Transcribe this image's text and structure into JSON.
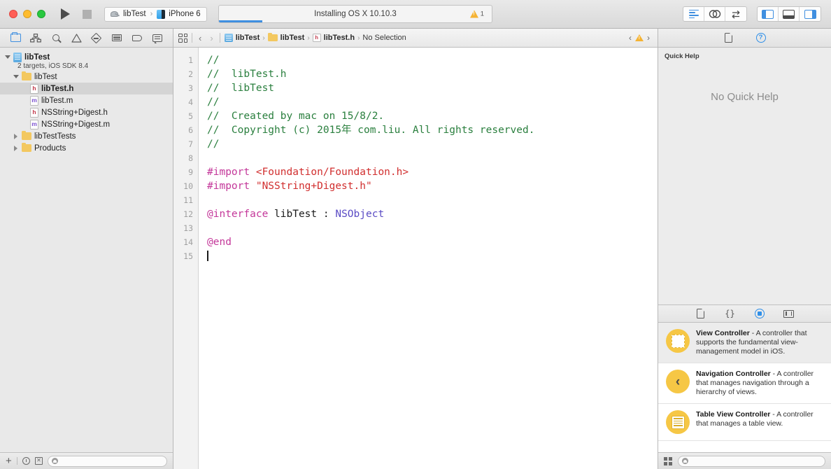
{
  "toolbar": {
    "run_label": "Run",
    "stop_label": "Stop",
    "scheme": {
      "project": "libTest",
      "separator": "›",
      "destination": "iPhone 6"
    },
    "status": {
      "text": "Installing OS X 10.10.3",
      "progress_percent": 16,
      "warning_count": "1"
    },
    "editor_modes": [
      "standard-editor",
      "assistant-editor",
      "version-editor"
    ],
    "view_toggles": [
      "navigator-pane",
      "debug-pane",
      "utilities-pane"
    ]
  },
  "navigator": {
    "tabs": [
      "project-navigator",
      "symbol-navigator",
      "find-navigator",
      "issue-navigator",
      "test-navigator",
      "debug-navigator",
      "breakpoint-navigator",
      "report-navigator"
    ],
    "project": {
      "name": "libTest",
      "subtitle": "2 targets, iOS SDK 8.4"
    },
    "tree": [
      {
        "label": "libTest",
        "kind": "folder",
        "depth": 1,
        "expanded": true,
        "selected": false
      },
      {
        "label": "libTest.h",
        "kind": "header",
        "depth": 2,
        "expanded": null,
        "selected": true
      },
      {
        "label": "libTest.m",
        "kind": "impl",
        "depth": 2,
        "expanded": null,
        "selected": false
      },
      {
        "label": "NSString+Digest.h",
        "kind": "header",
        "depth": 2,
        "expanded": null,
        "selected": false
      },
      {
        "label": "NSString+Digest.m",
        "kind": "impl",
        "depth": 2,
        "expanded": null,
        "selected": false
      },
      {
        "label": "libTestTests",
        "kind": "folder",
        "depth": 1,
        "expanded": false,
        "selected": false
      },
      {
        "label": "Products",
        "kind": "folder",
        "depth": 1,
        "expanded": false,
        "selected": false
      }
    ],
    "footer": {
      "add_label": "+",
      "filter_placeholder": ""
    }
  },
  "editor": {
    "jumpbar": {
      "breadcrumbs": [
        "libTest",
        "libTest",
        "libTest.h",
        "No Selection"
      ],
      "separator": "›",
      "back_label": "‹",
      "forward_label": "›",
      "prev_issue_label": "‹",
      "next_issue_label": "›"
    },
    "line_numbers": [
      "1",
      "2",
      "3",
      "4",
      "5",
      "6",
      "7",
      "8",
      "9",
      "10",
      "11",
      "12",
      "13",
      "14",
      "15"
    ],
    "code_lines": [
      {
        "n": 1,
        "tokens": [
          {
            "t": "//",
            "c": "cm"
          }
        ]
      },
      {
        "n": 2,
        "tokens": [
          {
            "t": "//  libTest.h",
            "c": "cm"
          }
        ]
      },
      {
        "n": 3,
        "tokens": [
          {
            "t": "//  libTest",
            "c": "cm"
          }
        ]
      },
      {
        "n": 4,
        "tokens": [
          {
            "t": "//",
            "c": "cm"
          }
        ]
      },
      {
        "n": 5,
        "tokens": [
          {
            "t": "//  Created by mac on 15/8/2.",
            "c": "cm"
          }
        ]
      },
      {
        "n": 6,
        "tokens": [
          {
            "t": "//  Copyright (c) 2015年 com.liu. All rights reserved.",
            "c": "cm"
          }
        ]
      },
      {
        "n": 7,
        "tokens": [
          {
            "t": "//",
            "c": "cm"
          }
        ]
      },
      {
        "n": 8,
        "tokens": []
      },
      {
        "n": 9,
        "tokens": [
          {
            "t": "#import ",
            "c": "pp"
          },
          {
            "t": "<Foundation/Foundation.h>",
            "c": "str"
          }
        ]
      },
      {
        "n": 10,
        "tokens": [
          {
            "t": "#import ",
            "c": "pp"
          },
          {
            "t": "\"NSString+Digest.h\"",
            "c": "str"
          }
        ]
      },
      {
        "n": 11,
        "tokens": []
      },
      {
        "n": 12,
        "tokens": [
          {
            "t": "@interface ",
            "c": "kw"
          },
          {
            "t": "libTest ",
            "c": "pl"
          },
          {
            "t": ": ",
            "c": "pl"
          },
          {
            "t": "NSObject",
            "c": "ty"
          }
        ]
      },
      {
        "n": 13,
        "tokens": []
      },
      {
        "n": 14,
        "tokens": [
          {
            "t": "@end",
            "c": "kw"
          }
        ]
      },
      {
        "n": 15,
        "tokens": [],
        "caret": true
      }
    ]
  },
  "utilities": {
    "tabs": [
      "file-inspector",
      "quick-help-inspector"
    ],
    "quick_help": {
      "title": "Quick Help",
      "empty_text": "No Quick Help"
    },
    "library_tabs": [
      "file-template-library",
      "code-snippet-library",
      "object-library",
      "media-library"
    ],
    "library_items": [
      {
        "name": "View Controller",
        "dash": " - ",
        "description": "A controller that supports the fundamental view-management model in iOS.",
        "icon": "view-controller-icon",
        "selected": true
      },
      {
        "name": "Navigation Controller",
        "dash": " - ",
        "description": "A controller that manages navigation through a hierarchy of views.",
        "icon": "navigation-controller-icon",
        "selected": false
      },
      {
        "name": "Table View Controller",
        "dash": " - ",
        "description": "A controller that manages a table view.",
        "icon": "table-view-controller-icon",
        "selected": false
      }
    ],
    "footer": {
      "filter_placeholder": ""
    }
  },
  "colors": {
    "accent": "#3f8fe0",
    "warning": "#f5b333",
    "comment": "#2a7f3e",
    "preprocessor": "#c4389a",
    "string": "#d12f2f",
    "type": "#5a4bc4",
    "library_icon": "#f6c745"
  }
}
